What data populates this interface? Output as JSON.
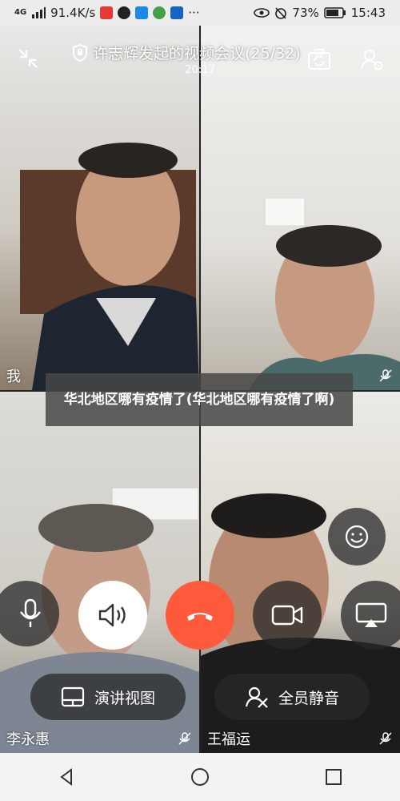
{
  "status_bar": {
    "signal": "4G",
    "speed": "91.4K/s",
    "more": "···",
    "battery_percent": "73%",
    "time": "15:43"
  },
  "meeting": {
    "title": "许志辉发起的视频会议(25/32)",
    "duration": "20:17"
  },
  "participants": [
    {
      "name": "我"
    },
    {
      "name": ""
    },
    {
      "name": "李永惠"
    },
    {
      "name": "王福运"
    }
  ],
  "banner": {
    "text": "华北地区哪有疫情了(华北地区哪有疫情了啊)"
  },
  "controls": {
    "speaker_view_label": "演讲视图",
    "mute_all_label": "全员静音"
  },
  "colors": {
    "hangup": "#ff5a3c",
    "control_dark": "rgba(40,40,40,0.75)",
    "control_light": "#ffffff"
  }
}
